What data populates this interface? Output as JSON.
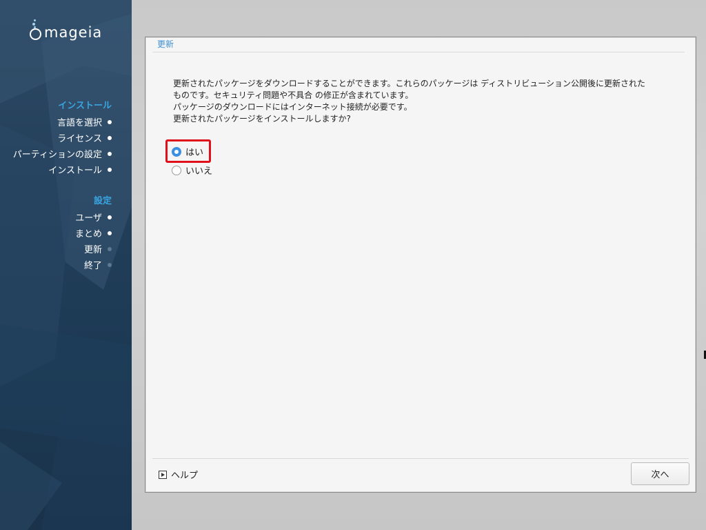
{
  "brand": {
    "logo_text": "mageia",
    "logo_icon": "mageia-cauldron-logo"
  },
  "sidebar": {
    "groups": [
      {
        "header": "インストール",
        "items": [
          {
            "label": "言語を選択",
            "state": "done"
          },
          {
            "label": "ライセンス",
            "state": "done"
          },
          {
            "label": "パーティションの設定",
            "state": "done"
          },
          {
            "label": "インストール",
            "state": "done"
          }
        ]
      },
      {
        "header": "設定",
        "items": [
          {
            "label": "ユーザ",
            "state": "done"
          },
          {
            "label": "まとめ",
            "state": "done"
          },
          {
            "label": "更新",
            "state": "current"
          },
          {
            "label": "終了",
            "state": "pending"
          }
        ]
      }
    ]
  },
  "panel": {
    "title": "更新",
    "description": [
      "更新されたパッケージをダウンロードすることができます。これらのパッケージは ディストリビューション公開後に更新された",
      "ものです。セキュリティ問題や不具合 の修正が含まれています。",
      "パッケージのダウンロードにはインターネット接続が必要です。",
      "更新されたパッケージをインストールしますか?"
    ],
    "options": [
      {
        "label": "はい",
        "selected": true
      },
      {
        "label": "いいえ",
        "selected": false
      }
    ],
    "help_label": "ヘルプ",
    "next_label": "次へ"
  },
  "colors": {
    "accent": "#3aa4e0",
    "radio_selected": "#3b8fe4",
    "highlight": "#e0101a",
    "sidebar_bg": "#23405a"
  }
}
